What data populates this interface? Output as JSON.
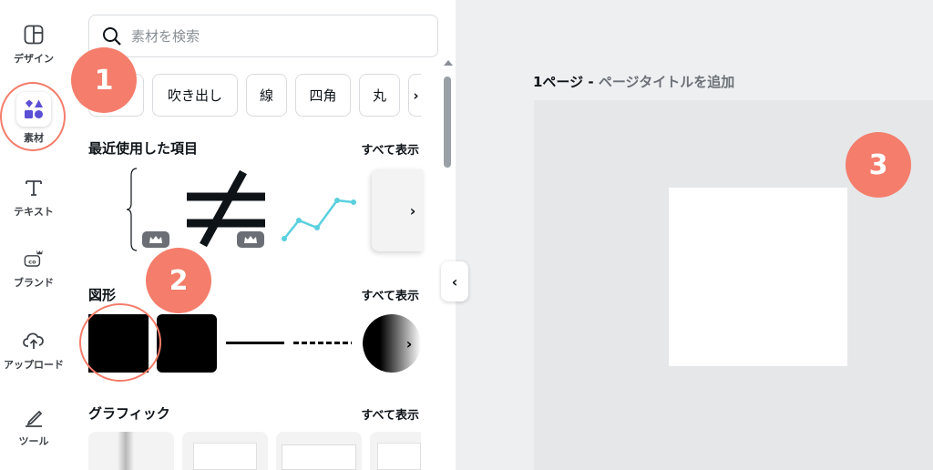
{
  "rail": {
    "items": [
      {
        "label": "デザイン",
        "icon": "layout-icon"
      },
      {
        "label": "素材",
        "icon": "elements-icon"
      },
      {
        "label": "テキスト",
        "icon": "text-icon"
      },
      {
        "label": "ブランド",
        "icon": "brand-icon"
      },
      {
        "label": "アップロード",
        "icon": "upload-cloud-icon"
      },
      {
        "label": "ツール",
        "icon": "draw-tool-icon"
      }
    ]
  },
  "search": {
    "placeholder": "素材を検索"
  },
  "chips": [
    "吹き出し",
    "線",
    "四角",
    "丸"
  ],
  "sections": {
    "recent": {
      "title": "最近使用した項目",
      "see_all": "すべて表示"
    },
    "shapes": {
      "title": "図形",
      "see_all": "すべて表示"
    },
    "graphics": {
      "title": "グラフィック",
      "see_all": "すべて表示"
    }
  },
  "recent_items": {
    "not_equal": "≠",
    "brace": "{"
  },
  "workspace": {
    "page_number": "1ページ -",
    "page_title_placeholder": "ページタイトルを追加"
  },
  "markers": [
    "1",
    "2",
    "3"
  ],
  "colors": {
    "accent": "#f47d6b",
    "elements_icon": "#5b4fd6",
    "line_chart": "#5ad0de"
  }
}
